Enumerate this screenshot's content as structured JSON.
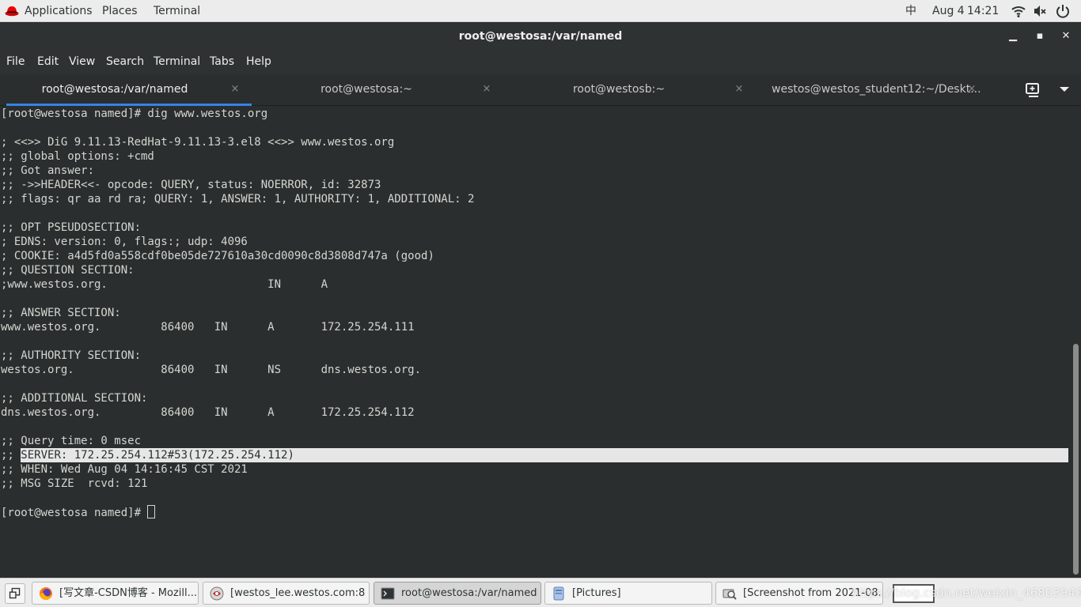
{
  "topbar": {
    "applications": "Applications",
    "places": "Places",
    "terminal": "Terminal",
    "input_method": "中",
    "date": "Aug 4",
    "time": "14:21",
    "icons": [
      "wifi-icon",
      "volume-icon",
      "power-icon"
    ]
  },
  "window": {
    "title": "root@westosa:/var/named",
    "controls": {
      "minimize": "▁",
      "maximize": "▪",
      "close": "✕"
    }
  },
  "menubar": {
    "file": "File",
    "edit": "Edit",
    "view": "View",
    "search": "Search",
    "terminal": "Terminal",
    "tabs": "Tabs",
    "help": "Help"
  },
  "tabs": [
    {
      "label": "root@westosa:/var/named",
      "active": true
    },
    {
      "label": "root@westosa:~",
      "active": false
    },
    {
      "label": "root@westosb:~",
      "active": false
    },
    {
      "label": "westos@westos_student12:~/Deskt...",
      "active": false
    }
  ],
  "tab_close": "×",
  "terminal": {
    "lines": [
      "[root@westosa named]# dig www.westos.org",
      "",
      "; <<>> DiG 9.11.13-RedHat-9.11.13-3.el8 <<>> www.westos.org",
      ";; global options: +cmd",
      ";; Got answer:",
      ";; ->>HEADER<<- opcode: QUERY, status: NOERROR, id: 32873",
      ";; flags: qr aa rd ra; QUERY: 1, ANSWER: 1, AUTHORITY: 1, ADDITIONAL: 2",
      "",
      ";; OPT PSEUDOSECTION:",
      "; EDNS: version: 0, flags:; udp: 4096",
      "; COOKIE: a4d5fd0a558cdf0be05de727610a30cd0090c8d3808d747a (good)",
      ";; QUESTION SECTION:",
      ";www.westos.org.                        IN      A",
      "",
      ";; ANSWER SECTION:",
      "www.westos.org.         86400   IN      A       172.25.254.111",
      "",
      ";; AUTHORITY SECTION:",
      "westos.org.             86400   IN      NS      dns.westos.org.",
      "",
      ";; ADDITIONAL SECTION:",
      "dns.westos.org.         86400   IN      A       172.25.254.112",
      "",
      ";; Query time: 0 msec",
      ";; SERVER: 172.25.254.112#53(172.25.254.112)",
      ";; WHEN: Wed Aug 04 14:16:45 CST 2021",
      ";; MSG SIZE  rcvd: 121",
      "",
      "[root@westosa named]# "
    ],
    "highlighted_line_index": 24,
    "highlight_prefix": ";; ",
    "colors": {
      "background": "#2b2e2f",
      "foreground": "#d3d7cf",
      "highlight": "#e6e6e6"
    }
  },
  "taskbar": {
    "items": [
      {
        "label": "[写文章-CSDN博客 - Mozill...",
        "icon": "firefox-icon"
      },
      {
        "label": "[westos_lee.westos.com:8 ...",
        "icon": "remote-viewer-icon"
      },
      {
        "label": "root@westosa:/var/named",
        "icon": "terminal-icon",
        "active": true
      },
      {
        "label": "[Pictures]",
        "icon": "file-manager-icon"
      },
      {
        "label": "[Screenshot from 2021-08...",
        "icon": "screenshot-icon"
      }
    ],
    "watermark": "https://blog.csdn.net/weixin_46803940"
  },
  "accent_color": "#3584e4"
}
